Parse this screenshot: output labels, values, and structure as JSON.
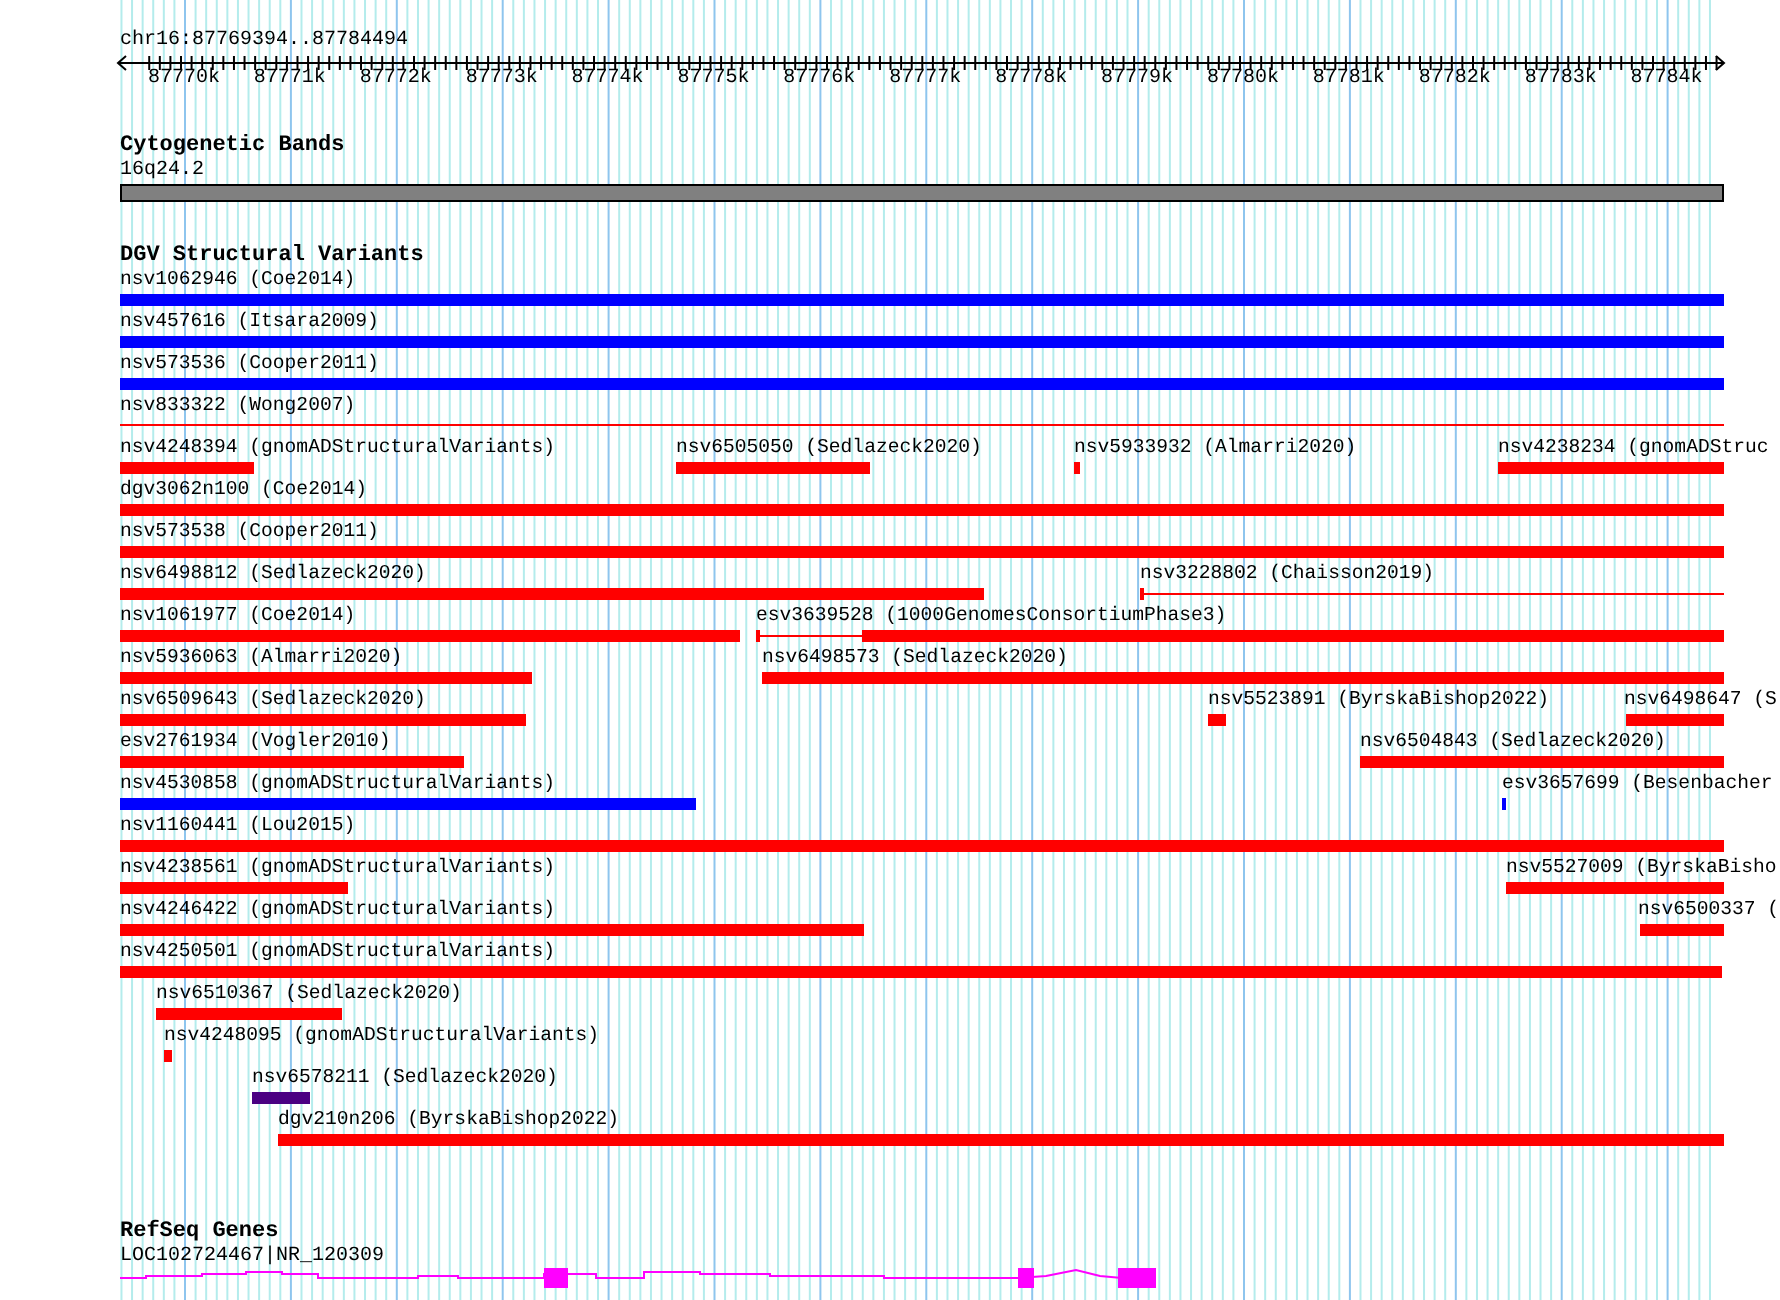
{
  "ruler": {
    "location": "chr16:87769394..87784494",
    "ticks": [
      "87770k",
      "87771k",
      "87772k",
      "87773k",
      "87774k",
      "87775k",
      "87776k",
      "87777k",
      "87778k",
      "87779k",
      "87780k",
      "87781k",
      "87782k",
      "87783k",
      "87784k"
    ]
  },
  "tracks": [
    {
      "kind": "bands",
      "title": "Cytogenetic Bands",
      "features": [
        {
          "label": "16q24.2"
        }
      ]
    },
    {
      "kind": "variants",
      "title": "DGV Structural Variants",
      "features": [
        {
          "label": "nsv1062946 (Coe2014)",
          "kind": "bar",
          "color": "#0000ff"
        },
        {
          "label": "nsv457616 (Itsara2009)",
          "kind": "bar",
          "color": "#0000ff"
        },
        {
          "label": "nsv573536 (Cooper2011)",
          "kind": "bar",
          "color": "#0000ff"
        },
        {
          "label": "nsv833322 (Wong2007)",
          "kind": "line",
          "color": "#ff0000"
        },
        {
          "label": "nsv4248394 (gnomADStructuralVariants)",
          "kind": "bar",
          "color": "#ff0000"
        },
        {
          "label": "nsv6505050 (Sedlazeck2020)",
          "kind": "bar",
          "color": "#ff0000"
        },
        {
          "label": "nsv5933932 (Almarri2020)",
          "kind": "bar",
          "color": "#ff0000"
        },
        {
          "label": "nsv4238234 (gnomADStruc",
          "kind": "bar",
          "color": "#ff0000"
        },
        {
          "label": "dgv3062n100 (Coe2014)",
          "kind": "bar",
          "color": "#ff0000"
        },
        {
          "label": "nsv573538 (Cooper2011)",
          "kind": "bar",
          "color": "#ff0000"
        },
        {
          "label": "nsv6498812 (Sedlazeck2020)",
          "kind": "bar",
          "color": "#ff0000"
        },
        {
          "label": "nsv3228802 (Chaisson2019)",
          "kind": "split",
          "color": "#ff0000"
        },
        {
          "label": "nsv1061977 (Coe2014)",
          "kind": "bar",
          "color": "#ff0000"
        },
        {
          "label": "esv3639528 (1000GenomesConsortiumPhase3)",
          "kind": "split",
          "color": "#ff0000"
        },
        {
          "label": "nsv5936063 (Almarri2020)",
          "kind": "bar",
          "color": "#ff0000"
        },
        {
          "label": "nsv6498573 (Sedlazeck2020)",
          "kind": "bar",
          "color": "#ff0000"
        },
        {
          "label": "nsv6509643 (Sedlazeck2020)",
          "kind": "bar",
          "color": "#ff0000"
        },
        {
          "label": "nsv5523891 (ByrskaBishop2022)",
          "kind": "bar",
          "color": "#ff0000"
        },
        {
          "label": "nsv6498647 (S",
          "kind": "bar",
          "color": "#ff0000"
        },
        {
          "label": "esv2761934 (Vogler2010)",
          "kind": "bar",
          "color": "#ff0000"
        },
        {
          "label": "nsv6504843 (Sedlazeck2020)",
          "kind": "bar",
          "color": "#ff0000"
        },
        {
          "label": "nsv4530858 (gnomADStructuralVariants)",
          "kind": "bar",
          "color": "#0000ff"
        },
        {
          "label": "esv3657699 (Besenbacher",
          "kind": "bar",
          "color": "#0000ff"
        },
        {
          "label": "nsv1160441 (Lou2015)",
          "kind": "bar",
          "color": "#ff0000"
        },
        {
          "label": "nsv4238561 (gnomADStructuralVariants)",
          "kind": "bar",
          "color": "#ff0000"
        },
        {
          "label": "nsv5527009 (ByrskaBisho",
          "kind": "bar",
          "color": "#ff0000"
        },
        {
          "label": "nsv4246422 (gnomADStructuralVariants)",
          "kind": "bar",
          "color": "#ff0000"
        },
        {
          "label": "nsv6500337 (",
          "kind": "bar",
          "color": "#ff0000"
        },
        {
          "label": "nsv4250501 (gnomADStructuralVariants)",
          "kind": "bar",
          "color": "#ff0000"
        },
        {
          "label": "nsv6510367 (Sedlazeck2020)",
          "kind": "bar",
          "color": "#ff0000"
        },
        {
          "label": "nsv4248095 (gnomADStructuralVariants)",
          "kind": "bar",
          "color": "#ff0000"
        },
        {
          "label": "nsv6578211 (Sedlazeck2020)",
          "kind": "bar",
          "color": "#4b0082"
        },
        {
          "label": "dgv210n206 (ByrskaBishop2022)",
          "kind": "bar",
          "color": "#ff0000"
        }
      ]
    },
    {
      "kind": "genes",
      "title": "RefSeq Genes",
      "features": [
        {
          "label": "LOC102724467|NR_120309"
        }
      ]
    }
  ]
}
